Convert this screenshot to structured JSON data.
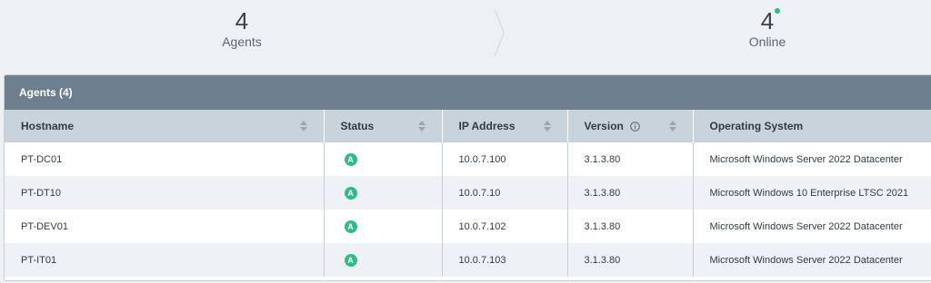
{
  "summary": {
    "agents": {
      "value": "4",
      "label": "Agents"
    },
    "online": {
      "value": "4",
      "label": "Online",
      "indicator_color": "#2ebd85"
    }
  },
  "panel": {
    "title": "Agents (4)"
  },
  "table": {
    "columns": [
      {
        "label": "Hostname",
        "sortable": true
      },
      {
        "label": "Status",
        "sortable": true
      },
      {
        "label": "IP Address",
        "sortable": true
      },
      {
        "label": "Version",
        "sortable": true,
        "info_icon": "info-icon"
      },
      {
        "label": "Operating System",
        "sortable": false
      }
    ],
    "rows": [
      {
        "hostname": "PT-DC01",
        "status": "A",
        "ip": "10.0.7.100",
        "version": "3.1.3.80",
        "os": "Microsoft Windows Server 2022 Datacenter"
      },
      {
        "hostname": "PT-DT10",
        "status": "A",
        "ip": "10.0.7.10",
        "version": "3.1.3.80",
        "os": "Microsoft Windows 10 Enterprise LTSC 2021"
      },
      {
        "hostname": "PT-DEV01",
        "status": "A",
        "ip": "10.0.7.102",
        "version": "3.1.3.80",
        "os": "Microsoft Windows Server 2022 Datacenter"
      },
      {
        "hostname": "PT-IT01",
        "status": "A",
        "ip": "10.0.7.103",
        "version": "3.1.3.80",
        "os": "Microsoft Windows Server 2022 Datacenter"
      }
    ]
  },
  "colors": {
    "header_bar": "#6d7e8e",
    "column_header": "#c9d3dc",
    "status_active": "#2ebd85"
  }
}
